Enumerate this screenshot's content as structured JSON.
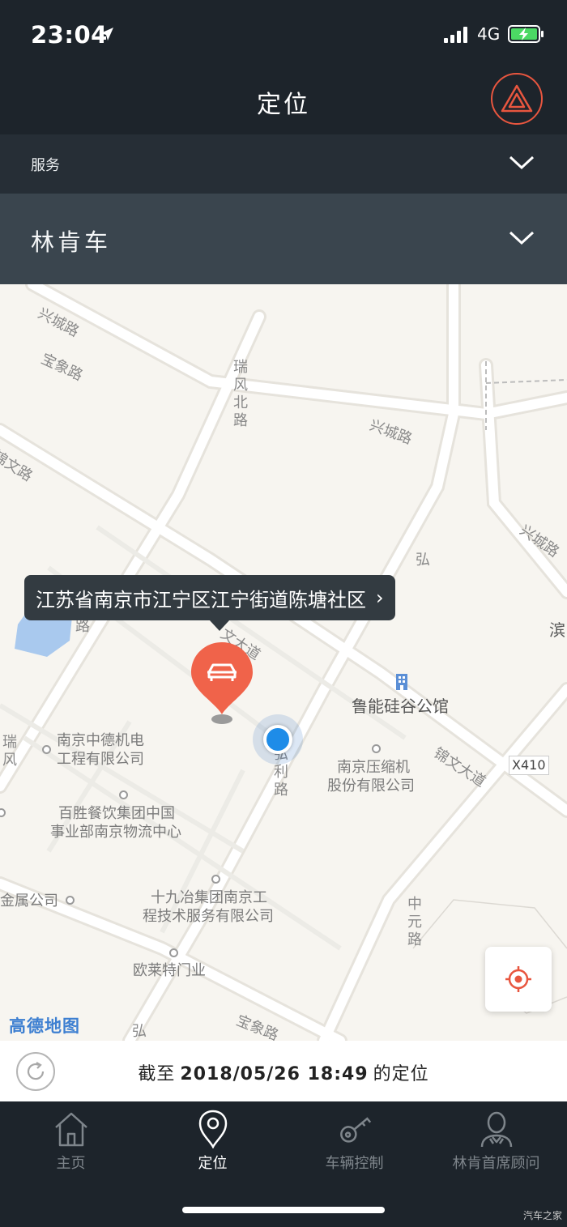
{
  "status_bar": {
    "time": "23:04",
    "network": "4G"
  },
  "header": {
    "title": "定位"
  },
  "service_selector": {
    "label": "服务"
  },
  "vehicle_selector": {
    "label": "林肯车"
  },
  "map": {
    "address_callout": "江苏省南京市江宁区江宁街道陈塘社区",
    "logo": "高德地图",
    "poi_labels": {
      "lu_neng": "鲁能硅谷公馆",
      "zhongde_1": "南京中德机电",
      "zhongde_2": "工程有限公司",
      "yasuo_1": "南京压缩机",
      "yasuo_2": "股份有限公司",
      "baisheng_1": "百胜餐饮集团中国",
      "baisheng_2": "事业部南京物流中心",
      "shijiuye_1": "十九冶集团南京工",
      "shijiuye_2": "程技术服务有限公司",
      "oulaite": "欧莱特门业",
      "jinshu": "金属公司",
      "x410": "X410",
      "bin": "滨"
    },
    "road_labels": {
      "xingcheng_1": "兴城路",
      "xingcheng_2": "兴城路",
      "xingcheng_3": "兴城路",
      "ruifeng_bei": "瑞风北路",
      "jinwen_left": "锦文路",
      "jinwen_dadao": "锦文大道",
      "jinwen_dadao_partial": "文大道",
      "hong_top": "弘",
      "hongli": "弘利路",
      "zhongyuan": "中元路",
      "baoxiang_1": "宝象路",
      "baoxiang_2": "宝象路",
      "lu_partial": "路",
      "ruifeng": "瑞风",
      "hong_bottom": "弘"
    }
  },
  "refresh_bar": {
    "prefix": "截至",
    "datetime": "2018/05/26 18:49",
    "suffix": "的定位"
  },
  "tabs": [
    {
      "label": "主页",
      "icon": "home-icon"
    },
    {
      "label": "定位",
      "icon": "location-pin-icon"
    },
    {
      "label": "车辆控制",
      "icon": "key-icon"
    },
    {
      "label": "林肯首席顾问",
      "icon": "advisor-icon"
    }
  ],
  "watermark": "汽车之家",
  "colors": {
    "accent": "#e8563f",
    "user_location": "#1e8ce8",
    "map_logo": "#3d7fd1"
  }
}
